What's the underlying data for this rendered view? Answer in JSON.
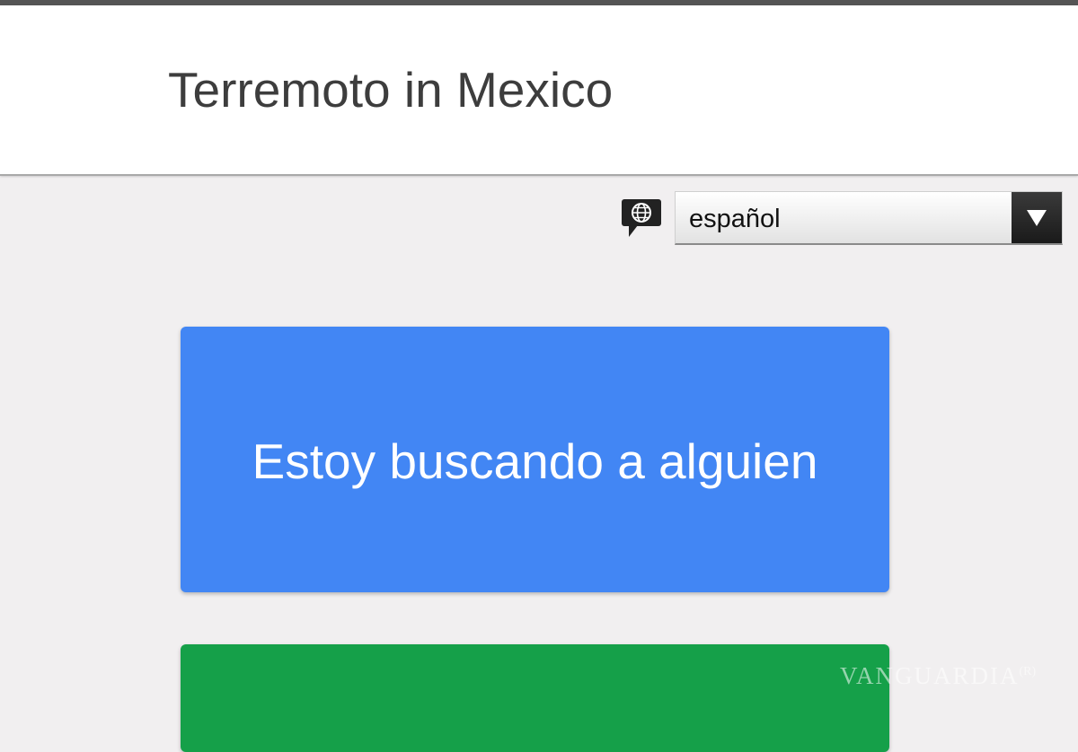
{
  "header": {
    "title": "Terremoto in Mexico"
  },
  "language_selector": {
    "icon": "globe-speech-bubble-icon",
    "selected": "español",
    "arrow_icon": "triangle-down-icon"
  },
  "actions": {
    "search_label": "Estoy buscando a alguien",
    "search_color": "#4286f4",
    "info_color": "#15a049"
  },
  "watermark": {
    "text": "VANGUARDIA",
    "mark": "(R)"
  }
}
